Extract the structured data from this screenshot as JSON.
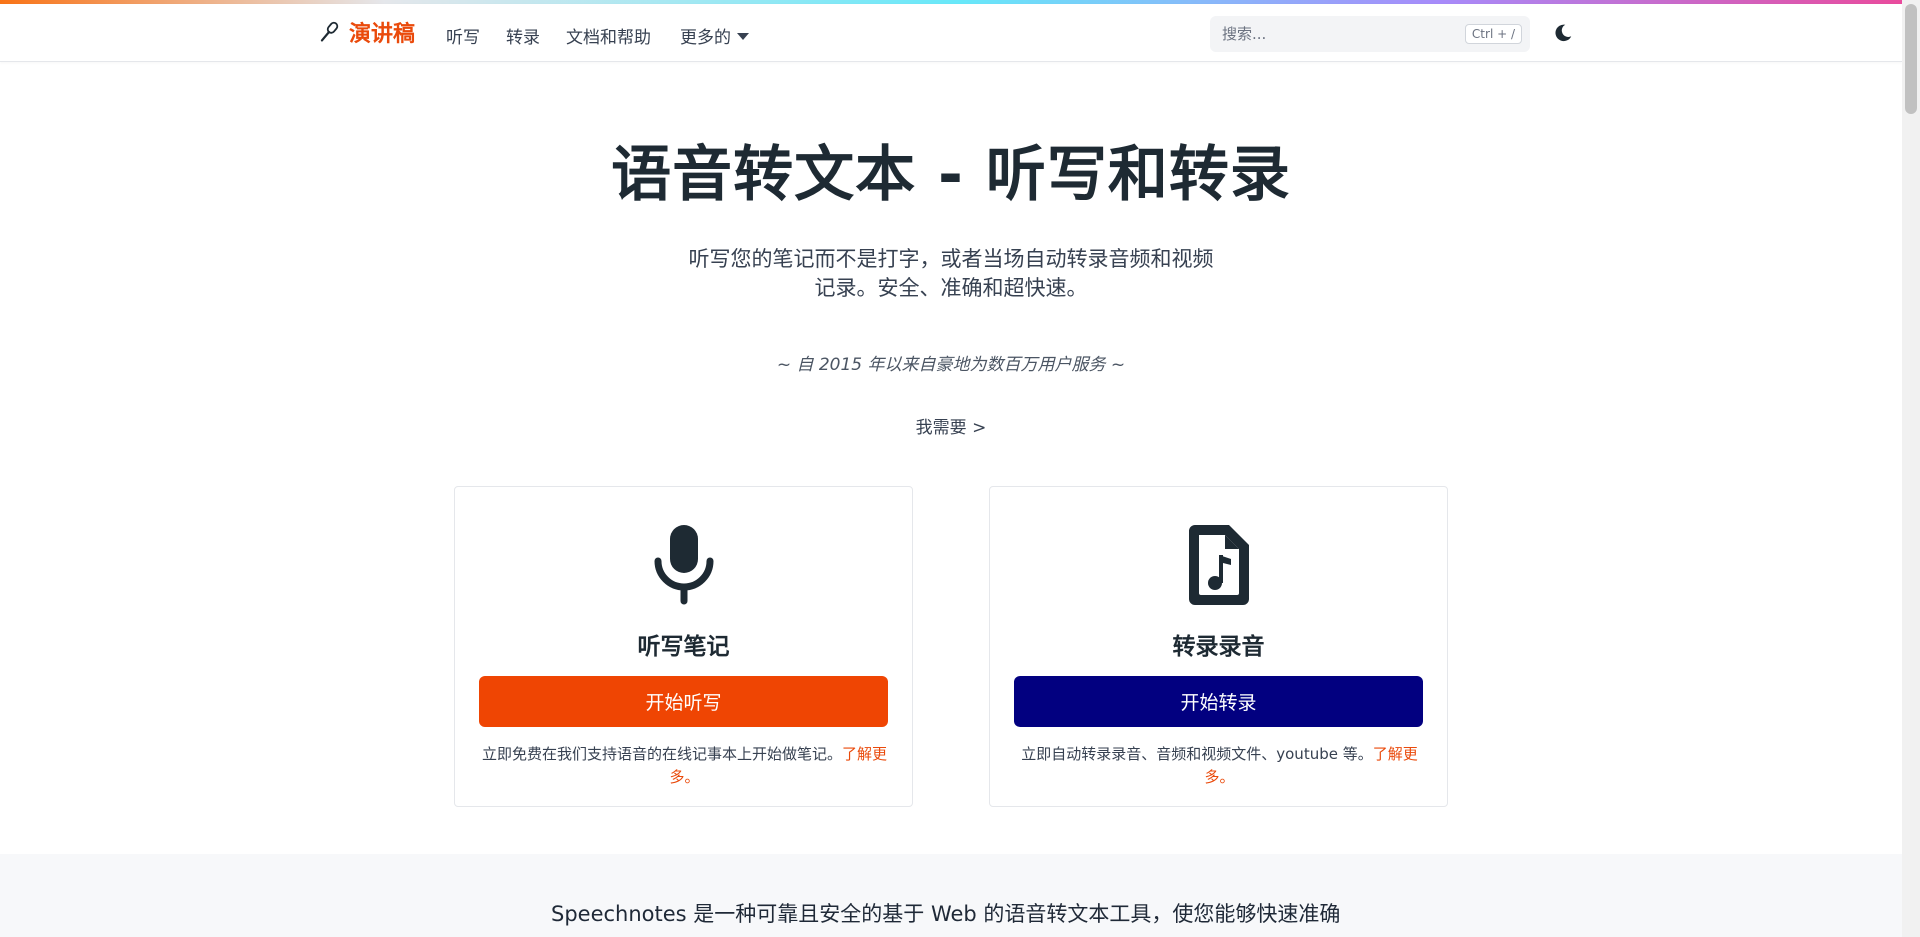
{
  "nav": {
    "brand": "演讲稿",
    "links": [
      "听写",
      "转录",
      "文档和帮助",
      "更多的"
    ],
    "search_placeholder": "搜索...",
    "search_shortcut": "Ctrl + /"
  },
  "hero": {
    "title": "语音转文本 - 听写和转录",
    "subtitle_line1": "听写您的笔记而不是打字，或者当场自动转录音频和视频",
    "subtitle_line2": "记录。安全、准确和超快速。",
    "since": "~ 自 2015 年以来自豪地为数百万用户服务 ~",
    "i_need": "我需要 >"
  },
  "cards": [
    {
      "title": "听写笔记",
      "button": "开始听写",
      "desc": "立即免费在我们支持语音的在线记事本上开始做笔记。",
      "link": "了解更多。",
      "icon": "microphone-icon",
      "color": "#ef4503"
    },
    {
      "title": "转录录音",
      "button": "开始转录",
      "desc": "立即自动转录录音、音频和视频文件、youtube 等。",
      "link": "了解更多。",
      "icon": "audio-file-icon",
      "color": "#020080"
    }
  ],
  "about": {
    "text": "Speechnotes 是一种可靠且安全的基于 Web 的语音转文本工具，使您能够快速准确"
  }
}
